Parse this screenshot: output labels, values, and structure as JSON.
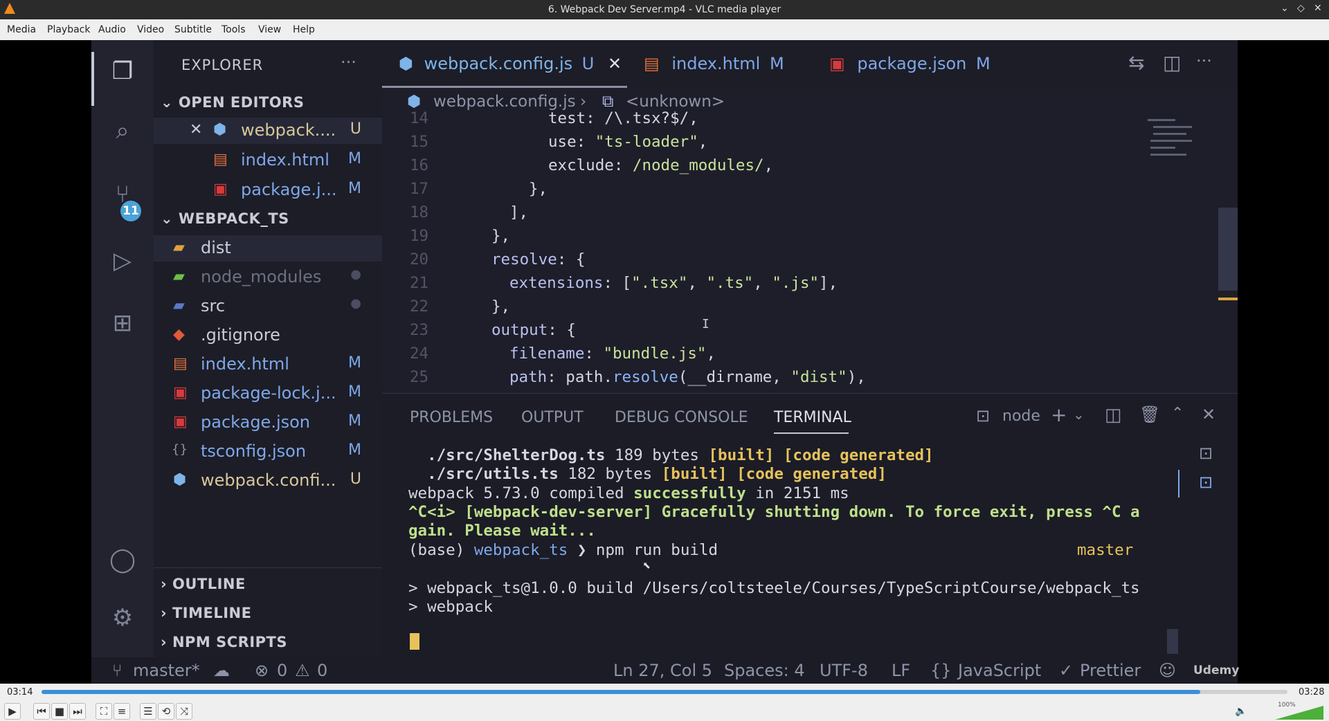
{
  "vlc": {
    "title": "6. Webpack Dev Server.mp4 - VLC media player",
    "menu": [
      "Media",
      "Playback",
      "Audio",
      "Video",
      "Subtitle",
      "Tools",
      "View",
      "Help"
    ],
    "time_elapsed": "03:14",
    "time_total": "03:28",
    "progress": 0.93,
    "volume_label": "100%",
    "watermark": "Udemy"
  },
  "vscode": {
    "explorer_title": "EXPLORER",
    "open_editors_label": "OPEN EDITORS",
    "open_editors": [
      {
        "name": "webpack....",
        "badge": "U"
      },
      {
        "name": "index.html",
        "badge": "M"
      },
      {
        "name": "package.j...",
        "badge": "M"
      }
    ],
    "project_label": "WEBPACK_TS",
    "files": [
      {
        "name": "dist",
        "badge": ""
      },
      {
        "name": "node_modules",
        "badge": "●"
      },
      {
        "name": "src",
        "badge": "●"
      },
      {
        "name": ".gitignore",
        "badge": ""
      },
      {
        "name": "index.html",
        "badge": "M"
      },
      {
        "name": "package-lock.j...",
        "badge": "M"
      },
      {
        "name": "package.json",
        "badge": "M"
      },
      {
        "name": "tsconfig.json",
        "badge": "M"
      },
      {
        "name": "webpack.confi...",
        "badge": "U"
      }
    ],
    "outline_label": "OUTLINE",
    "timeline_label": "TIMELINE",
    "npm_scripts_label": "NPM SCRIPTS",
    "scm_badge": "11",
    "tabs": [
      {
        "name": "webpack.config.js",
        "badge": "U"
      },
      {
        "name": "index.html",
        "badge": "M"
      },
      {
        "name": "package.json",
        "badge": "M"
      }
    ],
    "breadcrumb": [
      "webpack.config.js",
      "<unknown>"
    ],
    "line_numbers": [
      "14",
      "15",
      "16",
      "17",
      "18",
      "19",
      "20",
      "21",
      "22",
      "23",
      "24",
      "25"
    ],
    "panel_tabs": [
      "PROBLEMS",
      "OUTPUT",
      "DEBUG CONSOLE",
      "TERMINAL"
    ],
    "terminal_shell": "node",
    "terminal": {
      "l1_file": "./src/ShelterDog.ts",
      "l1_size": "189 bytes",
      "l1_tags": "[built] [code generated]",
      "l2_file": "./src/utils.ts",
      "l2_size": "182 bytes",
      "l2_tags": "[built] [code generated]",
      "l3_pre": "webpack 5.73.0 compiled ",
      "l3_ok": "successfully",
      "l3_post": " in 2151 ms",
      "l4": "^C<i> [webpack-dev-server] Gracefully shutting down. To force exit, press ^C a",
      "l5": "gain. Please wait...",
      "l6_base": "(base)",
      "l6_dir": "webpack_ts",
      "l6_cmd": "❯ npm run build",
      "l6_branch": "master",
      "l7": "> webpack_ts@1.0.0 build /Users/coltsteele/Courses/TypeScriptCourse/webpack_ts",
      "l8": "> webpack"
    },
    "status": {
      "branch": "master*",
      "errors": "0",
      "warnings": "0",
      "position": "Ln 27, Col 5",
      "spaces": "Spaces: 4",
      "encoding": "UTF-8",
      "eol": "LF",
      "language": "JavaScript",
      "formatter": "Prettier"
    }
  }
}
